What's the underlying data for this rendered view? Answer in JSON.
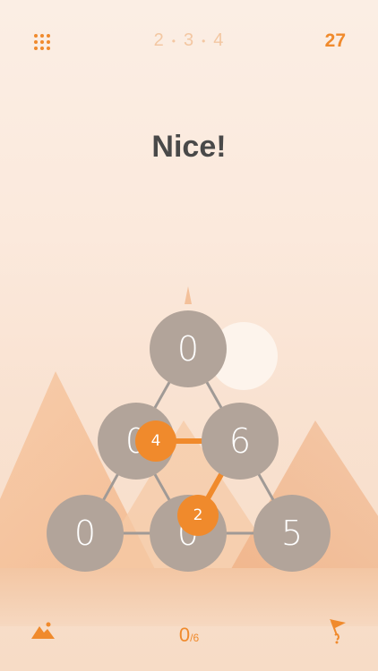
{
  "header": {
    "levels": [
      "2",
      "3",
      "4"
    ],
    "score": "27"
  },
  "status": {
    "message": "Nice!"
  },
  "board": {
    "nodes": [
      {
        "id": "top",
        "value": "0"
      },
      {
        "id": "mid-left",
        "value": "0"
      },
      {
        "id": "mid-right",
        "value": "6"
      },
      {
        "id": "bottom-left",
        "value": "0"
      },
      {
        "id": "bottom-center",
        "value": "0"
      },
      {
        "id": "bottom-right",
        "value": "5"
      }
    ],
    "markers": [
      {
        "value": "4"
      },
      {
        "value": "2"
      }
    ]
  },
  "footer": {
    "moves_done": "0",
    "moves_total": "/6"
  },
  "colors": {
    "accent": "#f08a2c",
    "node": "#b2a49a",
    "edge": "#a09a96",
    "text_dark": "#494949"
  },
  "icons": {
    "menu": "grid-dots-icon",
    "landscape": "mountain-landscape-icon",
    "hint": "hint-flag-icon"
  }
}
